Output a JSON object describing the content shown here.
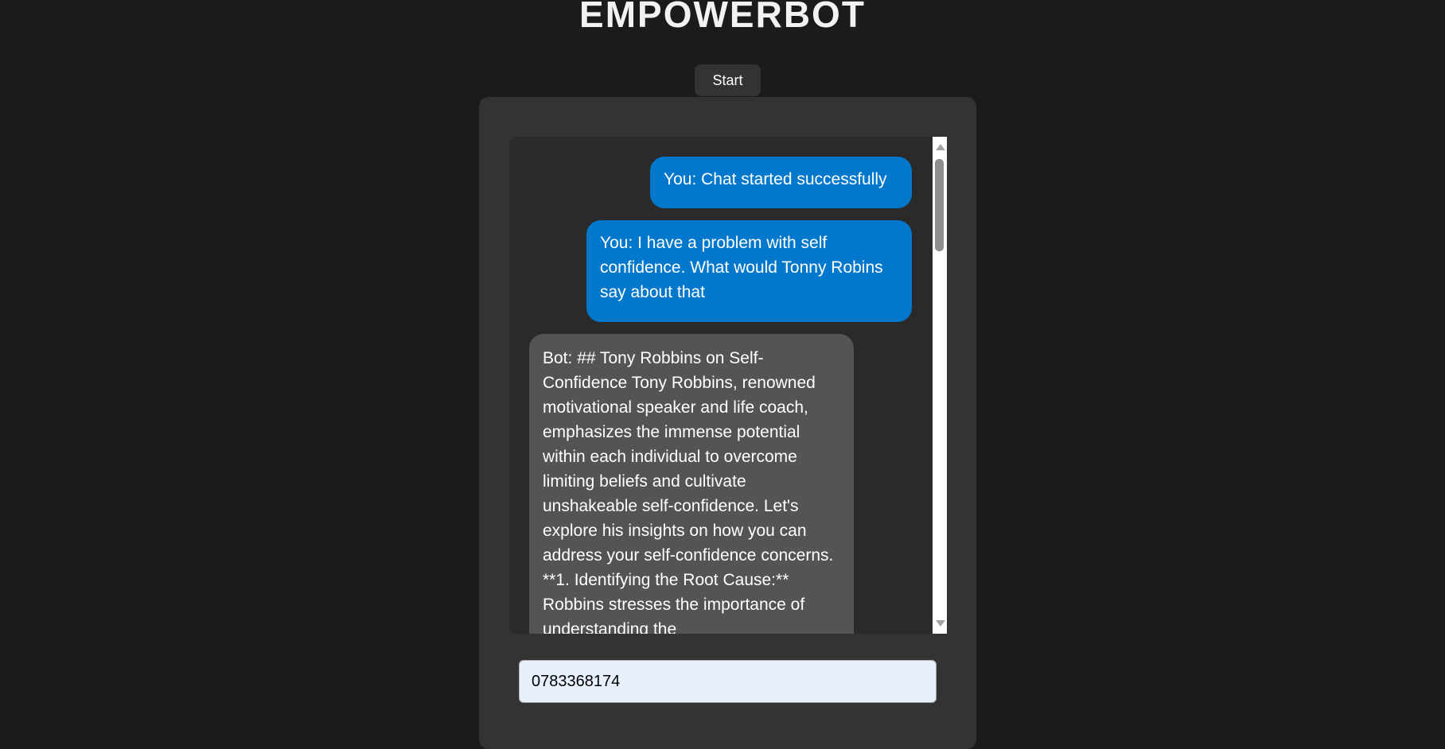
{
  "app": {
    "title": "EMPOWERBOT"
  },
  "controls": {
    "start_label": "Start"
  },
  "messages": [
    {
      "sender": "user",
      "text": "You: Chat started successfully"
    },
    {
      "sender": "user",
      "text": "You: I have a problem with self confidence. What would Tonny Robins say about that"
    },
    {
      "sender": "bot",
      "text": "Bot: ## Tony Robbins on Self-Confidence Tony Robbins, renowned motivational speaker and life coach, emphasizes the immense potential within each individual to overcome limiting beliefs and cultivate unshakeable self-confidence. Let's explore his insights on how you can address your self-confidence concerns. **1. Identifying the Root Cause:** Robbins stresses the importance of understanding the"
    }
  ],
  "input": {
    "value": "0783368174"
  },
  "colors": {
    "background": "#1b1b1b",
    "panel": "#333333",
    "messages_box": "#2a2a2a",
    "user_bubble": "#0278cc",
    "bot_bubble": "#545454",
    "input_background": "#e8f0fe"
  },
  "icons": {
    "scroll_up": "scroll-up-arrow-icon",
    "scroll_down": "scroll-down-arrow-icon"
  }
}
